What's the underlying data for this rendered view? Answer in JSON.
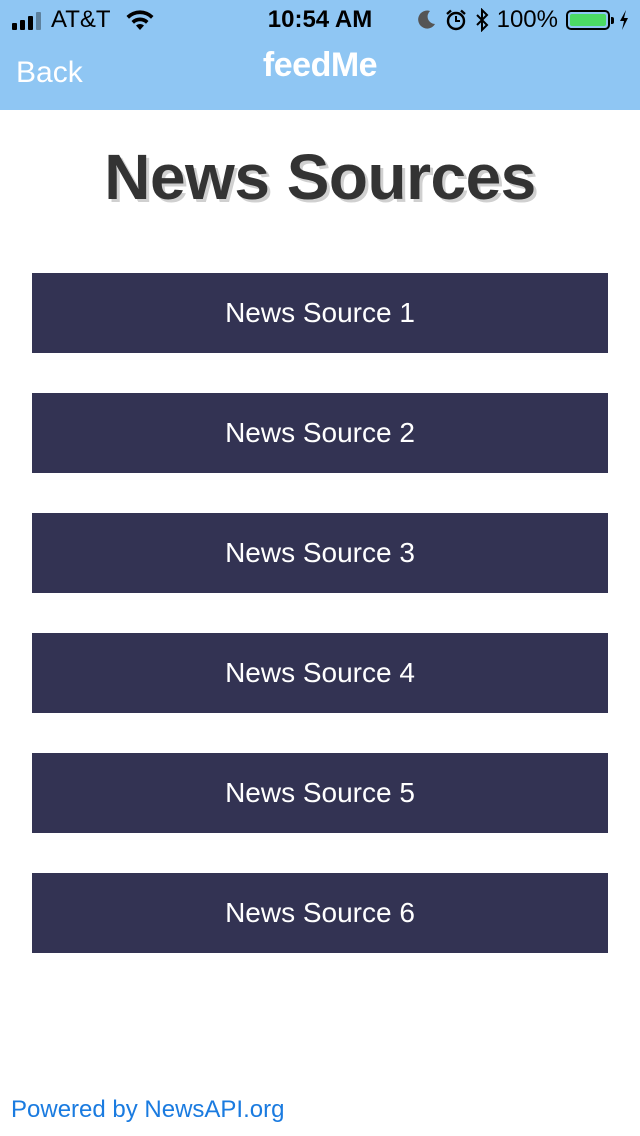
{
  "status_bar": {
    "carrier": "AT&T",
    "time": "10:54 AM",
    "battery": "100%",
    "battery_color": "#4cd964"
  },
  "nav": {
    "back_label": "Back",
    "title": "feedMe",
    "background_color": "#8fc6f3"
  },
  "page": {
    "title": "News Sources"
  },
  "sources": [
    {
      "label": "News Source 1"
    },
    {
      "label": "News Source 2"
    },
    {
      "label": "News Source 3"
    },
    {
      "label": "News Source 4"
    },
    {
      "label": "News Source 5"
    },
    {
      "label": "News Source 6"
    }
  ],
  "button_color": "#333353",
  "footer": {
    "link_text": "Powered by NewsAPI.org",
    "link_color": "#1a7be0"
  },
  "icons": [
    "signal-icon",
    "wifi-icon",
    "moon-icon",
    "alarm-icon",
    "bluetooth-icon",
    "battery-icon",
    "charging-icon"
  ]
}
